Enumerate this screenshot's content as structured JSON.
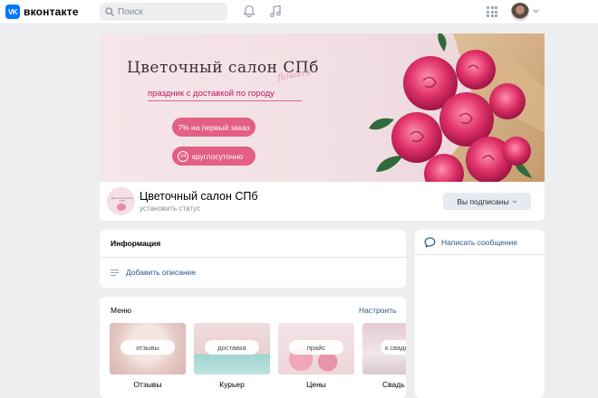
{
  "header": {
    "logo_badge": "VK",
    "logo_text": "вконтакте",
    "search_placeholder": "Поиск",
    "icons": [
      "vk-logo-icon",
      "search-icon",
      "bell-icon",
      "music-icon",
      "apps-grid-icon",
      "avatar",
      "chevron-down-icon"
    ]
  },
  "cover": {
    "title": "Цветочный салон СПб",
    "script": "flowers",
    "subtitle": "праздник с доставкой по городу",
    "pill_discount": "7% на первый заказ",
    "pill_clock": "24",
    "pill_hours": "круглосуточно"
  },
  "profile": {
    "avatar_text": "Цветочный салон СПб",
    "name": "Цветочный салон СПб",
    "status": "установить статус",
    "subscribed_label": "Вы подписаны"
  },
  "info": {
    "title": "Информация",
    "add_description": "Добавить описание"
  },
  "message": {
    "label": "Написать сообщение"
  },
  "menu": {
    "title": "Меню",
    "setup": "Настроить",
    "items": [
      {
        "badge": "отзывы",
        "label": "Отзывы"
      },
      {
        "badge": "доставка",
        "label": "Курьер"
      },
      {
        "badge": "прайс",
        "label": "Цены"
      },
      {
        "badge": "к свадь",
        "label": "Свадь"
      }
    ]
  },
  "colors": {
    "accent": "#0077ff",
    "link": "#2a5885",
    "pill": "#e35f83",
    "background": "#edeef0"
  }
}
